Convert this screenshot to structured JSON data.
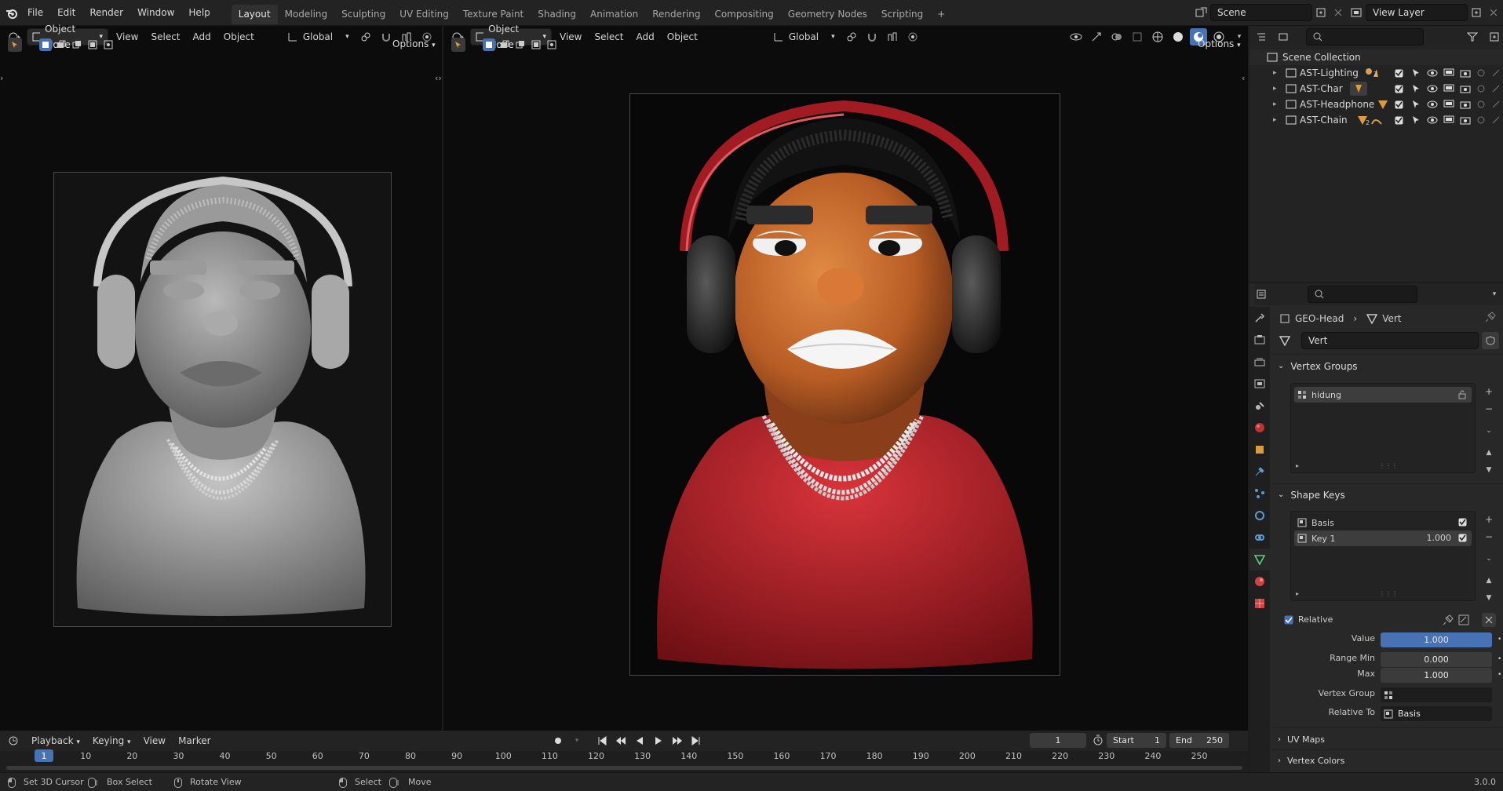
{
  "topbar": {
    "menus": [
      "File",
      "Edit",
      "Render",
      "Window",
      "Help"
    ],
    "workspaces": [
      "Layout",
      "Modeling",
      "Sculpting",
      "UV Editing",
      "Texture Paint",
      "Shading",
      "Animation",
      "Rendering",
      "Compositing",
      "Geometry Nodes",
      "Scripting"
    ],
    "active_workspace": "Layout",
    "add_tab": "+",
    "scene_name": "Scene",
    "view_layer": "View Layer"
  },
  "viewport_left": {
    "mode": "Object Mode",
    "menus": [
      "View",
      "Select",
      "Add",
      "Object"
    ],
    "transform": "Global",
    "options": "Options"
  },
  "viewport_right": {
    "mode": "Object Mode",
    "menus": [
      "View",
      "Select",
      "Add",
      "Object"
    ],
    "transform": "Global",
    "options": "Options"
  },
  "outliner": {
    "root": "Scene Collection",
    "items": [
      {
        "name": "AST-Lighting",
        "badge": "2"
      },
      {
        "name": "AST-Char",
        "badge": ""
      },
      {
        "name": "AST-Headphone",
        "badge": ""
      },
      {
        "name": "AST-Chain",
        "badge": "2"
      }
    ]
  },
  "properties": {
    "object": "GEO-Head",
    "mesh": "Vert",
    "mesh_field": "Vert",
    "vertex_groups_title": "Vertex Groups",
    "vertex_groups": [
      "hidung"
    ],
    "shape_keys_title": "Shape Keys",
    "shape_keys": [
      {
        "name": "Basis",
        "value": "",
        "checked": true
      },
      {
        "name": "Key 1",
        "value": "1.000",
        "checked": true
      }
    ],
    "relative_label": "Relative",
    "value_label": "Value",
    "value": "1.000",
    "range_min_label": "Range Min",
    "range_min": "0.000",
    "max_label": "Max",
    "max": "1.000",
    "vertex_group_label": "Vertex Group",
    "vertex_group_value": "",
    "relative_to_label": "Relative To",
    "relative_to": "Basis",
    "uv_maps": "UV Maps",
    "vertex_colors": "Vertex Colors"
  },
  "timeline": {
    "menus": [
      "Playback",
      "Keying",
      "View",
      "Marker"
    ],
    "current_frame": "1",
    "start_label": "Start",
    "start": "1",
    "end_label": "End",
    "end": "250",
    "ticks": [
      "1",
      "10",
      "20",
      "30",
      "40",
      "50",
      "60",
      "70",
      "80",
      "90",
      "100",
      "110",
      "120",
      "130",
      "140",
      "150",
      "160",
      "170",
      "180",
      "190",
      "200",
      "210",
      "220",
      "230",
      "240",
      "250"
    ]
  },
  "statusbar": {
    "items": [
      "Set 3D Cursor",
      "Box Select",
      "Rotate View",
      "Select",
      "Move"
    ],
    "version": "3.0.0"
  },
  "colors": {
    "accent": "#4772b3",
    "header": "#232323",
    "viewport": "#0c0c0c",
    "panel": "#282828"
  }
}
